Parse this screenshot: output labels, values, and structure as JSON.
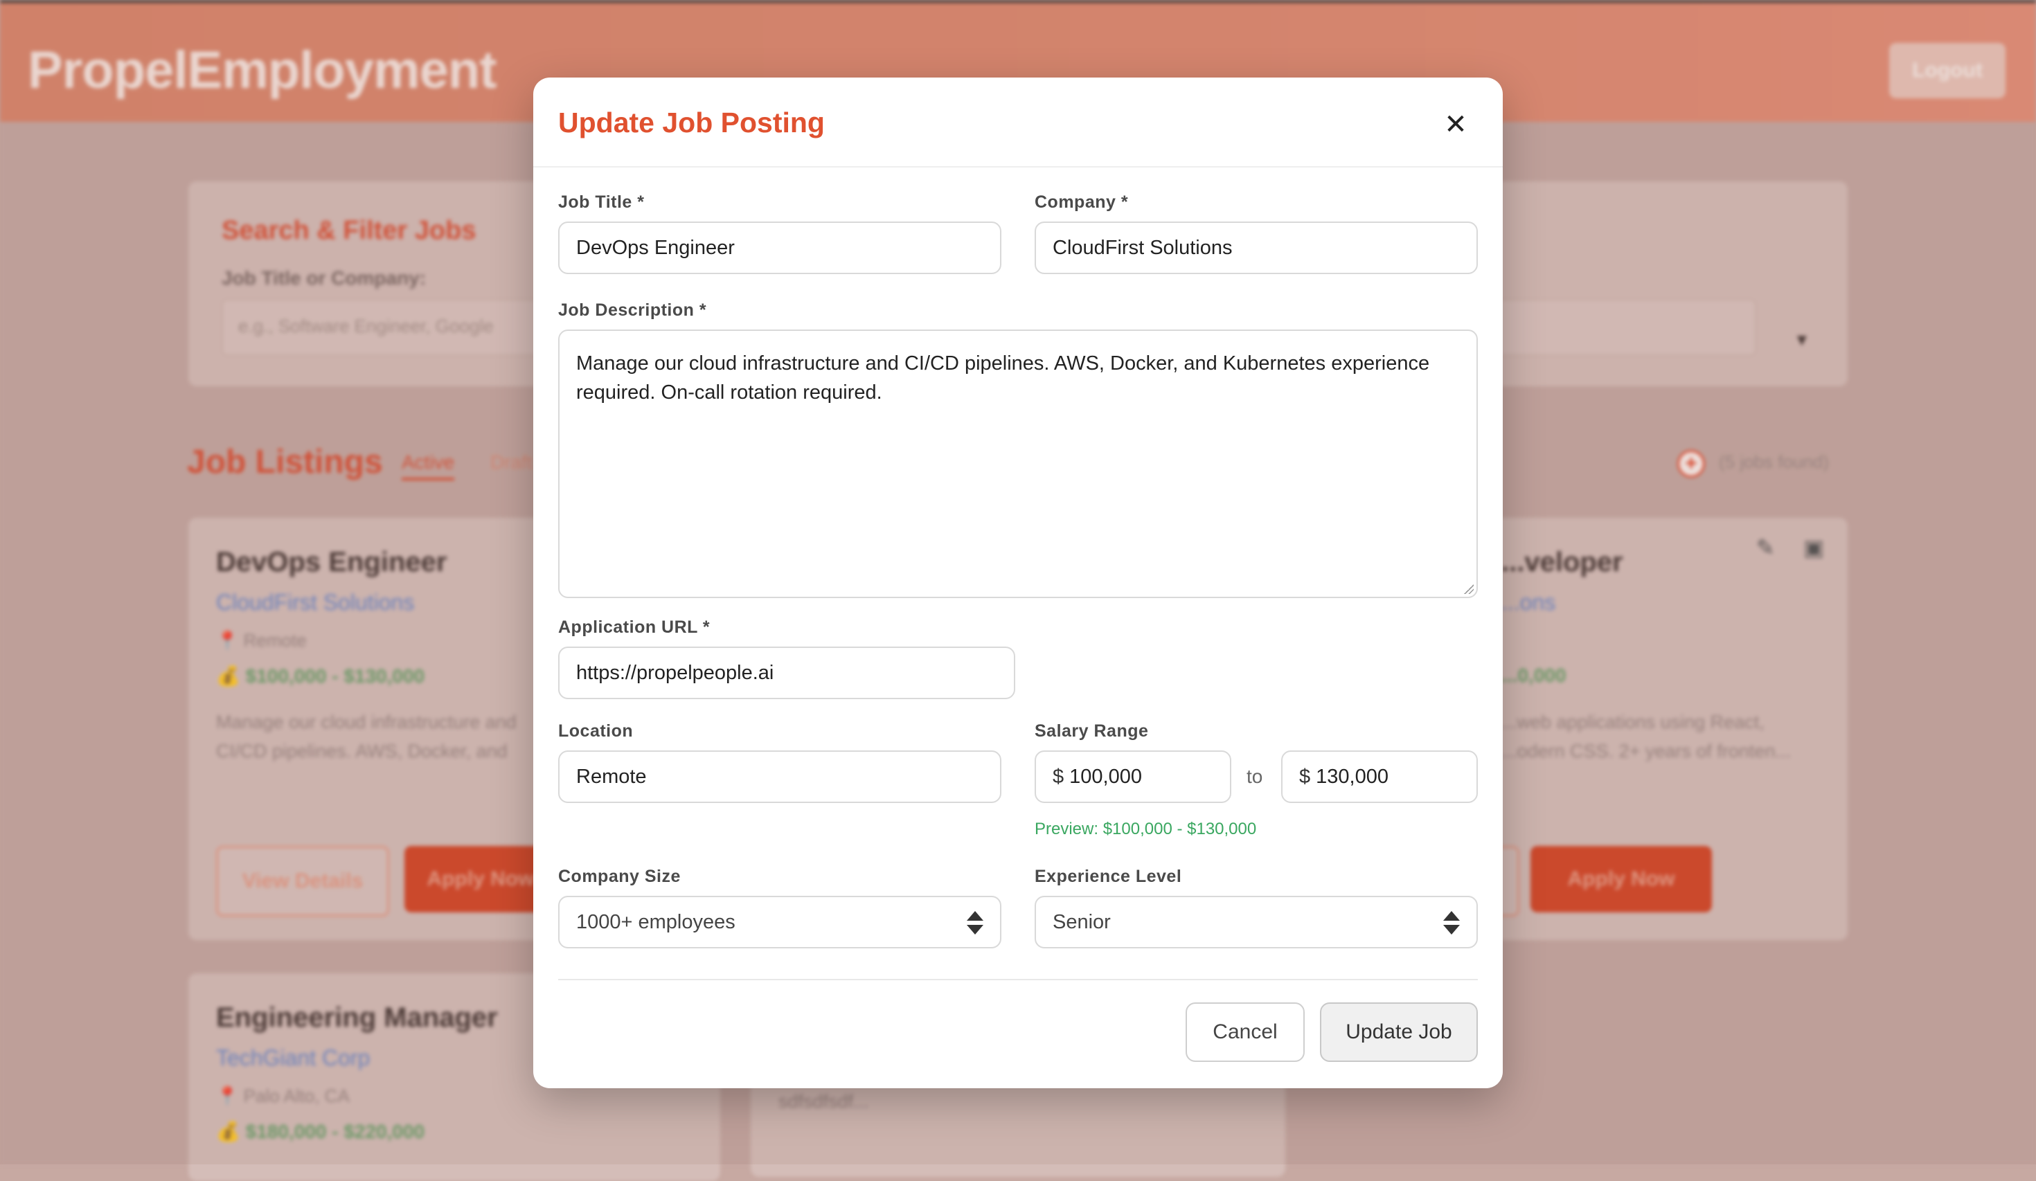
{
  "background": {
    "brand": "PropelEmployment",
    "logout_label": "Logout",
    "filter": {
      "title": "Search & Filter Jobs",
      "label": "Job Title or Company:",
      "placeholder": "e.g., Software Engineer, Google"
    },
    "listings": {
      "title": "Job Listings",
      "tabs": [
        "Active",
        "Draft"
      ],
      "count_text": "(5 jobs found)"
    },
    "cards": [
      {
        "title": "DevOps Engineer",
        "company": "CloudFirst Solutions",
        "location": "Remote",
        "salary": "$100,000 - $130,000",
        "description": "Manage our cloud infrastructure and CI/CD pipelines. AWS, Docker, and Kuber...",
        "view_label": "View Details",
        "apply_label": "Apply Now"
      },
      {
        "title": "...veloper",
        "company": "...ons",
        "salary": "...0,000",
        "description": "...web applications using React, ...odern CSS. 2+ years of fronten...",
        "apply_label": "Apply Now"
      },
      {
        "title": "Engineering Manager",
        "company": "TechGiant Corp",
        "location": "Palo Alto, CA",
        "salary": "$180,000 - $220,000"
      },
      {
        "description": "sdfsdfsdf..."
      }
    ]
  },
  "modal": {
    "title": "Update Job Posting",
    "close_symbol": "✕",
    "job_title": {
      "label": "Job Title *",
      "value": "DevOps Engineer"
    },
    "company": {
      "label": "Company *",
      "value": "CloudFirst Solutions"
    },
    "description": {
      "label": "Job Description *",
      "value": "Manage our cloud infrastructure and CI/CD pipelines. AWS, Docker, and Kubernetes experience required. On-call rotation required."
    },
    "application_url": {
      "label": "Application URL *",
      "value": "https://propelpeople.ai"
    },
    "location": {
      "label": "Location",
      "value": "Remote"
    },
    "salary": {
      "label": "Salary Range",
      "currency": "$",
      "min": "100,000",
      "max": "130,000",
      "to_label": "to",
      "preview": "Preview: $100,000 - $130,000"
    },
    "company_size": {
      "label": "Company Size",
      "value": "1000+ employees"
    },
    "experience_level": {
      "label": "Experience Level",
      "value": "Senior"
    },
    "cancel_label": "Cancel",
    "update_label": "Update Job"
  },
  "colors": {
    "accent": "#e0512f",
    "preview_green": "#3aa760"
  }
}
